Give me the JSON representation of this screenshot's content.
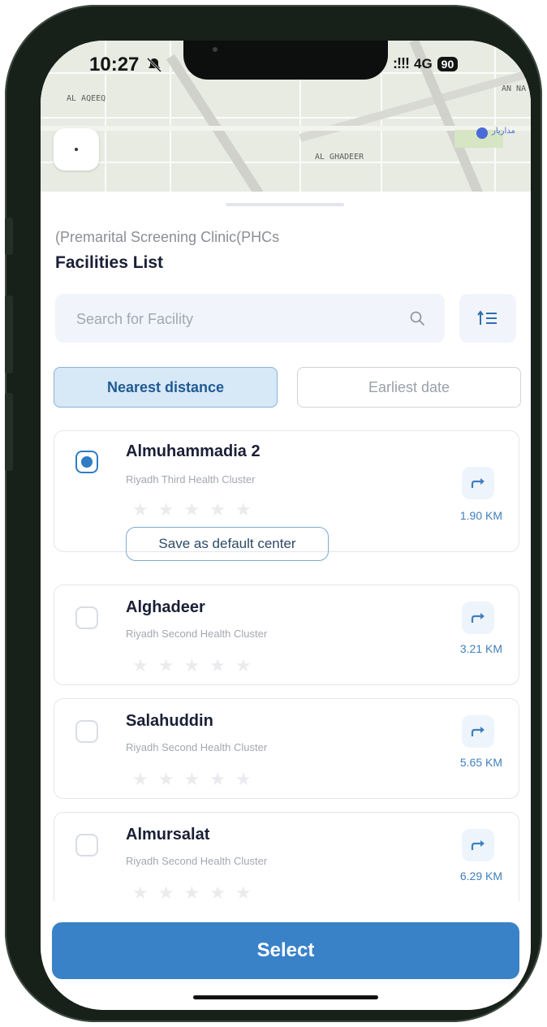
{
  "status_bar": {
    "time": "10:27",
    "signal": ":!!!",
    "network": "4G",
    "battery": "90"
  },
  "map": {
    "labels": [
      "AL AQEEQ",
      "AL GHADEER",
      "AN NA"
    ],
    "arabic_label": "مداريار"
  },
  "sheet": {
    "breadcrumb": "(Premarital Screening Clinic(PHCs",
    "title": "Facilities List",
    "search": {
      "placeholder": "Search for Facility",
      "value": ""
    },
    "filters": [
      {
        "label": "Nearest distance",
        "active": true
      },
      {
        "label": "Earliest date",
        "active": false
      }
    ]
  },
  "facilities": [
    {
      "name": "Almuhammadia 2",
      "cluster": "Riyadh Third Health Cluster",
      "distance": "1.90 KM",
      "selected": true,
      "rating": 0,
      "default_button": "Save as default center"
    },
    {
      "name": "Alghadeer",
      "cluster": "Riyadh Second Health Cluster",
      "distance": "3.21 KM",
      "selected": false,
      "rating": 0
    },
    {
      "name": "Salahuddin",
      "cluster": "Riyadh Second Health Cluster",
      "distance": "5.65 KM",
      "selected": false,
      "rating": 0
    },
    {
      "name": "Almursalat",
      "cluster": "Riyadh Second Health Cluster",
      "distance": "6.29 KM",
      "selected": false,
      "rating": 0
    }
  ],
  "actions": {
    "select_label": "Select"
  },
  "colors": {
    "primary": "#3a82c8",
    "filter_active_bg": "#d7e8f6",
    "selected": "#2e7dc4",
    "distance": "#3f7fbc"
  },
  "icons": {
    "back": "chevron-left-icon",
    "search": "search-icon",
    "sort": "sort-icon",
    "directions": "directions-icon",
    "star": "star-icon",
    "bell_silent": "bell-slash-icon"
  }
}
